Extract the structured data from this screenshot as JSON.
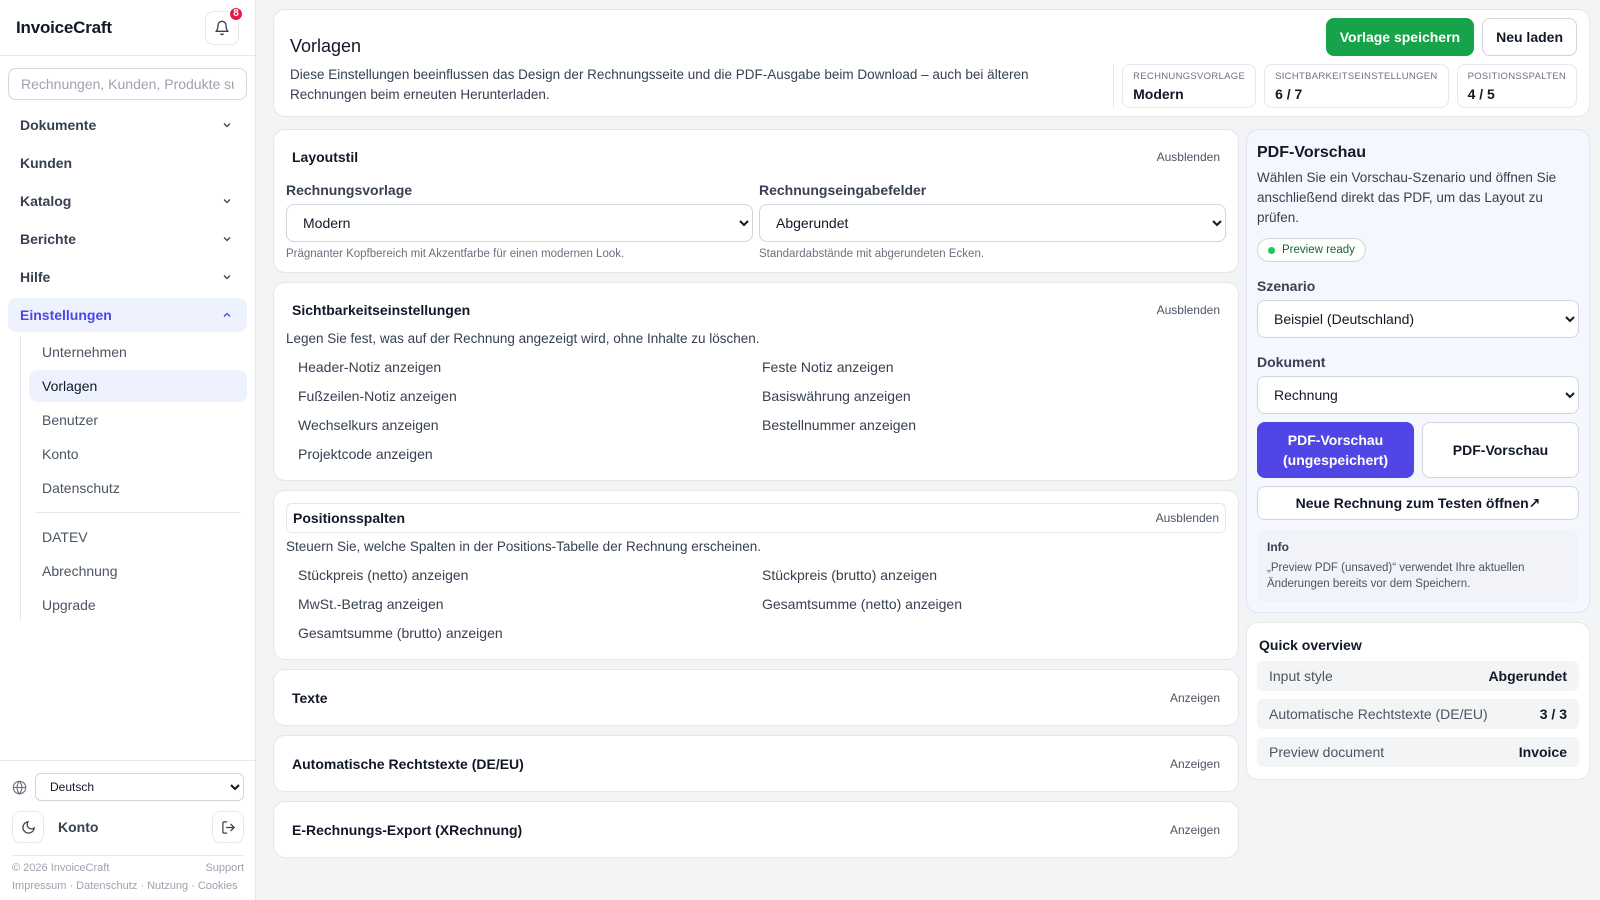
{
  "app": {
    "brand": "InvoiceCraft",
    "notification_count": "8"
  },
  "search": {
    "placeholder": "Rechnungen, Kunden, Produkte suchen"
  },
  "nav": {
    "items": [
      {
        "label": "Dokumente",
        "chevron": "down"
      },
      {
        "label": "Kunden",
        "chevron": ""
      },
      {
        "label": "Katalog",
        "chevron": "down"
      },
      {
        "label": "Berichte",
        "chevron": "down"
      },
      {
        "label": "Hilfe",
        "chevron": "down"
      },
      {
        "label": "Einstellungen",
        "chevron": "up"
      }
    ],
    "sub_items": [
      "Unternehmen",
      "Vorlagen",
      "Benutzer",
      "Konto",
      "Datenschutz"
    ],
    "sub_items2": [
      "DATEV",
      "Abrechnung",
      "Upgrade"
    ]
  },
  "bottom": {
    "language": "Deutsch",
    "account_label": "Konto",
    "copyright": "© 2026 InvoiceCraft",
    "support": "Support",
    "links": "Impressum · Datenschutz · Nutzung · Cookies"
  },
  "header": {
    "title": "Vorlagen",
    "description": "Diese Einstellungen beeinflussen das Design der Rechnungsseite und die PDF-Ausgabe beim Download – auch bei älteren Rechnungen beim erneuten Herunterladen.",
    "save_label": "Vorlage speichern",
    "reload_label": "Neu laden",
    "stats": [
      {
        "label": "Rechnungsvorlage",
        "value": "Modern"
      },
      {
        "label": "Sichtbarkeitseinstellungen",
        "value": "6 / 7"
      },
      {
        "label": "Positionsspalten",
        "value": "4 / 5"
      }
    ]
  },
  "layout": {
    "title": "Layoutstil",
    "toggle": "Ausblenden",
    "template_label": "Rechnungsvorlage",
    "template_value": "Modern",
    "template_hint": "Prägnanter Kopfbereich mit Akzentfarbe für einen modernen Look.",
    "input_label": "Rechnungseingabefelder",
    "input_value": "Abgerundet",
    "input_hint": "Standardabstände mit abgerundeten Ecken."
  },
  "visibility": {
    "title": "Sichtbarkeitseinstellungen",
    "toggle": "Ausblenden",
    "description": "Legen Sie fest, was auf der Rechnung angezeigt wird, ohne Inhalte zu löschen.",
    "options": [
      "Header-Notiz anzeigen",
      "Feste Notiz anzeigen",
      "Fußzeilen-Notiz anzeigen",
      "Basiswährung anzeigen",
      "Wechselkurs anzeigen",
      "Bestellnummer anzeigen",
      "Projektcode anzeigen"
    ]
  },
  "columns": {
    "title": "Positionsspalten",
    "toggle": "Ausblenden",
    "description": "Steuern Sie, welche Spalten in der Positions-Tabelle der Rechnung erscheinen.",
    "options": [
      "Stückpreis (netto) anzeigen",
      "Stückpreis (brutto) anzeigen",
      "MwSt.-Betrag anzeigen",
      "Gesamtsumme (netto) anzeigen",
      "Gesamtsumme (brutto) anzeigen"
    ]
  },
  "collapsed_sections": [
    {
      "title": "Texte",
      "toggle": "Anzeigen"
    },
    {
      "title": "Automatische Rechtstexte (DE/EU)",
      "toggle": "Anzeigen"
    },
    {
      "title": "E-Rechnungs-Export (XRechnung)",
      "toggle": "Anzeigen"
    }
  ],
  "preview": {
    "title": "PDF-Vorschau",
    "description": "Wählen Sie ein Vorschau-Szenario und öffnen Sie anschließend direkt das PDF, um das Layout zu prüfen.",
    "status": "Preview ready",
    "scenario_label": "Szenario",
    "scenario_value": "Beispiel (Deutschland)",
    "document_label": "Dokument",
    "document_value": "Rechnung",
    "btn_unsaved": "PDF-Vorschau (ungespeichert)",
    "btn_saved": "PDF-Vorschau",
    "btn_new": "Neue Rechnung zum Testen öffnen↗",
    "info_title": "Info",
    "info_text": "„Preview PDF (unsaved)“ verwendet Ihre aktuellen Änderungen bereits vor dem Speichern."
  },
  "overview": {
    "title": "Quick overview",
    "rows": [
      {
        "label": "Input style",
        "value": "Abgerundet"
      },
      {
        "label": "Automatische Rechtstexte (DE/EU)",
        "value": "3 / 3"
      },
      {
        "label": "Preview document",
        "value": "Invoice"
      }
    ]
  },
  "colors": {
    "accent": "#4f46e5",
    "save_green": "#16a34a",
    "badge": "#e11d48",
    "status_dot": "#22c55e"
  }
}
